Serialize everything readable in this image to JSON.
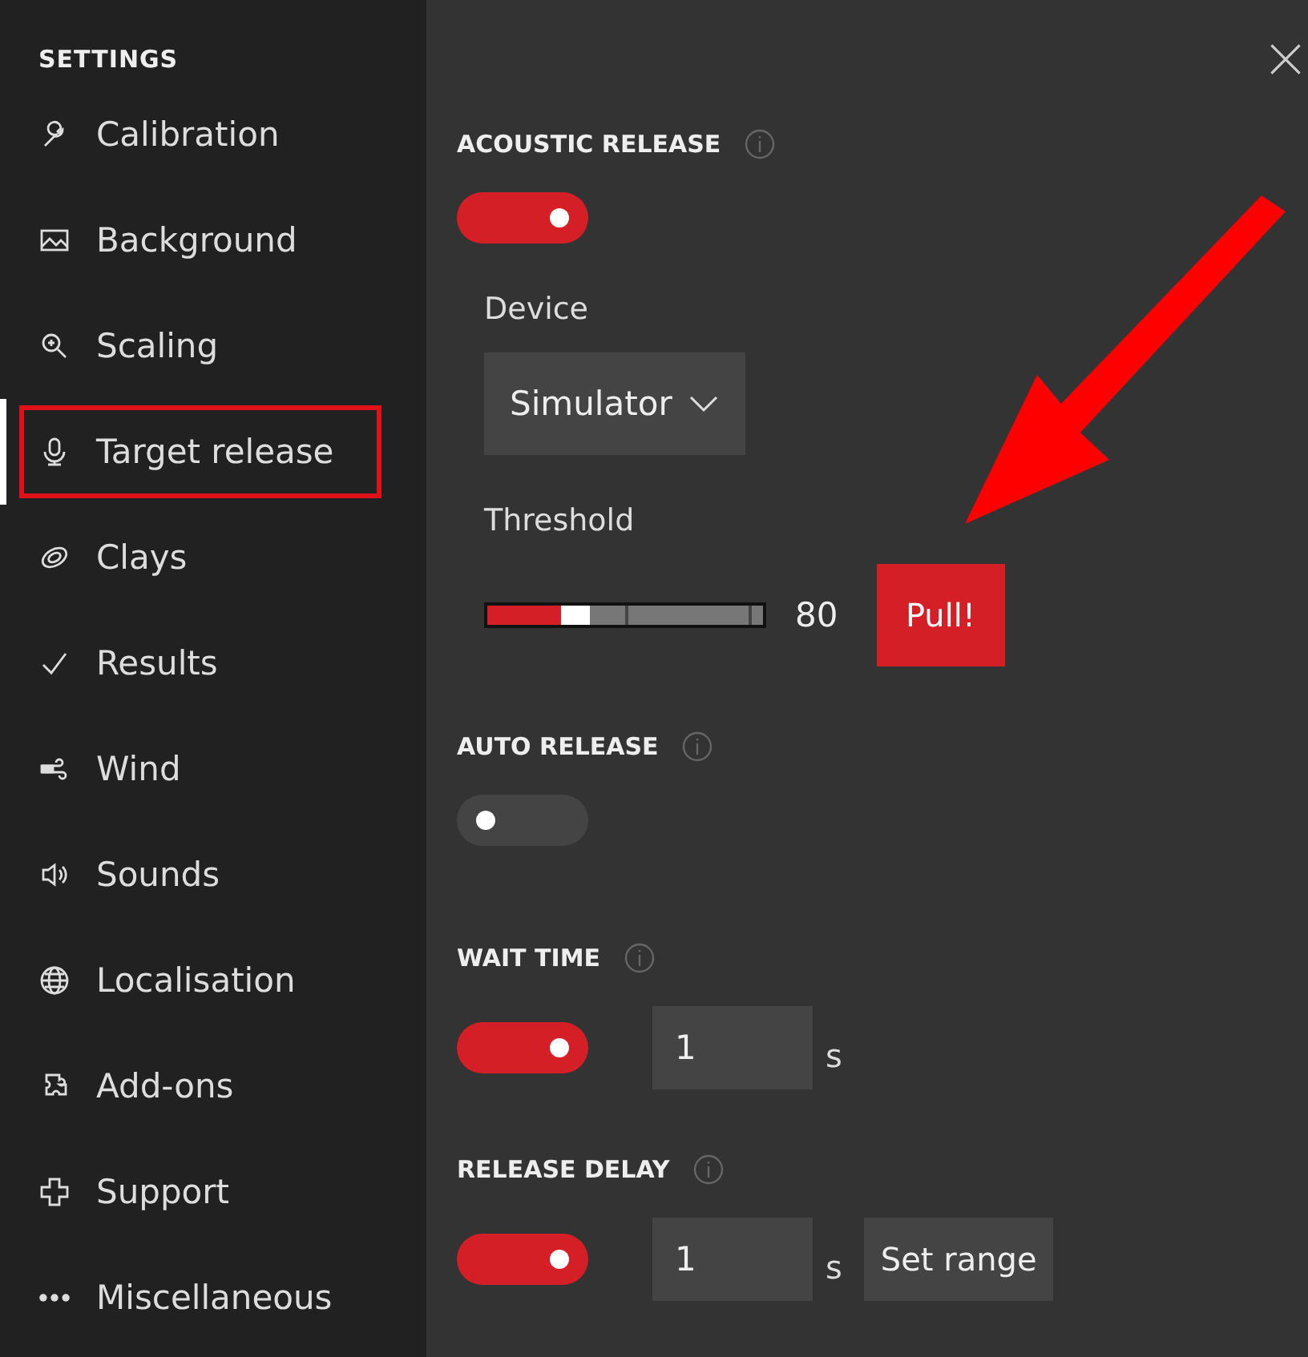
{
  "sidebar": {
    "title": "SETTINGS",
    "items": [
      {
        "label": "Calibration",
        "selected": false
      },
      {
        "label": "Background",
        "selected": false
      },
      {
        "label": "Scaling",
        "selected": false
      },
      {
        "label": "Target release",
        "selected": true
      },
      {
        "label": "Clays",
        "selected": false
      },
      {
        "label": "Results",
        "selected": false
      },
      {
        "label": "Wind",
        "selected": false
      },
      {
        "label": "Sounds",
        "selected": false
      },
      {
        "label": "Localisation",
        "selected": false
      },
      {
        "label": "Add-ons",
        "selected": false
      },
      {
        "label": "Support",
        "selected": false
      },
      {
        "label": "Miscellaneous",
        "selected": false
      }
    ]
  },
  "sections": [
    {
      "title": "ACOUSTIC RELEASE",
      "on": true,
      "device": {
        "label": "Device",
        "value": "Simulator"
      },
      "threshold": {
        "label": "Threshold",
        "level": 0.27,
        "reading": "80",
        "button": "Pull!"
      }
    },
    {
      "title": "AUTO RELEASE",
      "on": false
    },
    {
      "title": "WAIT TIME",
      "on": true,
      "value": "1",
      "unit": "s"
    },
    {
      "title": "RELEASE DELAY",
      "on": true,
      "value": "1",
      "unit": "s",
      "button": "Set range"
    }
  ]
}
